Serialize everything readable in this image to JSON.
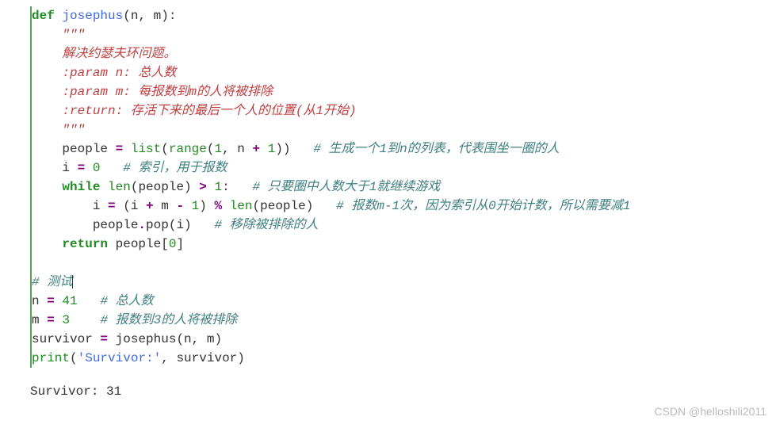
{
  "line1": {
    "kw": "def",
    "sp": " ",
    "fn": "josephus",
    "args": "(n, m):"
  },
  "line2": {
    "doc": "\"\"\""
  },
  "line3": {
    "doc": "解决约瑟夫环问题。"
  },
  "line4": {
    "doc": ":param n: 总人数"
  },
  "line5": {
    "doc": ":param m: 每报数到m的人将被排除"
  },
  "line6": {
    "doc": ":return: 存活下来的最后一个人的位置(从1开始)"
  },
  "line7": {
    "doc": "\"\"\""
  },
  "line8": {
    "a": "people ",
    "op1": "=",
    "b": " ",
    "bi1": "list",
    "c": "(",
    "bi2": "range",
    "d": "(",
    "n1": "1",
    "e": ", n ",
    "op2": "+",
    "f": " ",
    "n2": "1",
    "g": "))   ",
    "cm": "# 生成一个1到n的列表，代表围坐一圈的人"
  },
  "line9": {
    "a": "i ",
    "op": "=",
    "b": " ",
    "n": "0",
    "c": "   ",
    "cm": "# 索引，用于报数"
  },
  "line10": {
    "kw": "while",
    "a": " ",
    "bi": "len",
    "b": "(people) ",
    "op1": ">",
    "c": " ",
    "n": "1",
    "d": ":   ",
    "cm": "# 只要圈中人数大于1就继续游戏"
  },
  "line11": {
    "a": "i ",
    "op1": "=",
    "b": " (i ",
    "op2": "+",
    "c": " m ",
    "op3": "-",
    "d": " ",
    "n1": "1",
    "e": ") ",
    "op4": "%",
    "f": " ",
    "bi": "len",
    "g": "(people)   ",
    "cm": "# 报数m-1次，因为索引从0开始计数，所以需要减1"
  },
  "line12": {
    "a": "people",
    "op": ".",
    "b": "pop(i)   ",
    "cm": "# 移除被排除的人"
  },
  "line13": {
    "kw": "return",
    "a": " people[",
    "n": "0",
    "b": "]"
  },
  "line14": {
    "cm": "# 测试"
  },
  "line15": {
    "a": "n ",
    "op": "=",
    "b": " ",
    "n": "41",
    "c": "   ",
    "cm": "# 总人数"
  },
  "line16": {
    "a": "m ",
    "op": "=",
    "b": " ",
    "n": "3",
    "c": "    ",
    "cm": "# 报数到3的人将被排除"
  },
  "line17": {
    "a": "survivor ",
    "op": "=",
    "b": " josephus(n, m)"
  },
  "line18": {
    "bi": "print",
    "a": "(",
    "str": "'Survivor:'",
    "b": ", survivor)"
  },
  "output": "Survivor: 31",
  "watermark": "CSDN @helloshili2011"
}
